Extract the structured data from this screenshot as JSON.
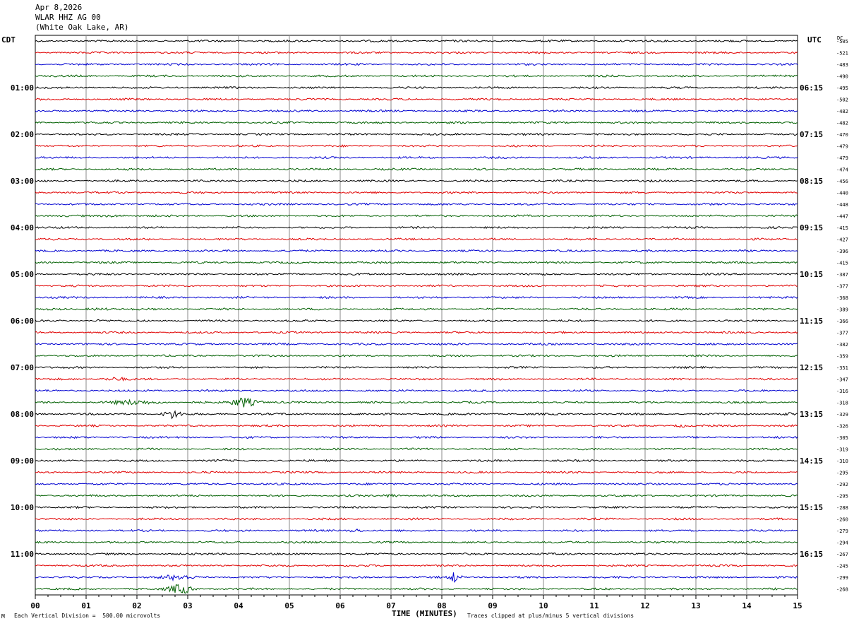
{
  "header": {
    "date": "Apr 8,2026",
    "station": "WLAR HHZ AG 00",
    "location": "(White Oak Lake, AR)"
  },
  "left_tz": "CDT",
  "right_tz": "UTC",
  "dc_label": "DC",
  "footer": {
    "scale": "Each Vertical Division =  500.00 microvolts",
    "clip": "Traces clipped at plus/minus 5 vertical divisions",
    "corner": "M"
  },
  "chart_data": {
    "type": "line",
    "title": "",
    "xlabel": "TIME (MINUTES)",
    "xlim": [
      0,
      15
    ],
    "x_ticks": [
      "00",
      "01",
      "02",
      "03",
      "04",
      "05",
      "06",
      "07",
      "08",
      "09",
      "10",
      "11",
      "12",
      "13",
      "14",
      "15"
    ],
    "trace_colors": [
      "#000000",
      "#e00000",
      "#0000d0",
      "#006000"
    ],
    "trace_count": 48,
    "left_time_labels": [
      {
        "row": 4,
        "label": "01:00"
      },
      {
        "row": 8,
        "label": "02:00"
      },
      {
        "row": 12,
        "label": "03:00"
      },
      {
        "row": 16,
        "label": "04:00"
      },
      {
        "row": 20,
        "label": "05:00"
      },
      {
        "row": 24,
        "label": "06:00"
      },
      {
        "row": 28,
        "label": "07:00"
      },
      {
        "row": 32,
        "label": "08:00"
      },
      {
        "row": 36,
        "label": "09:00"
      },
      {
        "row": 40,
        "label": "10:00"
      },
      {
        "row": 44,
        "label": "11:00"
      }
    ],
    "right_time_labels": [
      {
        "row": 4,
        "label": "06:15"
      },
      {
        "row": 8,
        "label": "07:15"
      },
      {
        "row": 12,
        "label": "08:15"
      },
      {
        "row": 16,
        "label": "09:15"
      },
      {
        "row": 20,
        "label": "10:15"
      },
      {
        "row": 24,
        "label": "11:15"
      },
      {
        "row": 28,
        "label": "12:15"
      },
      {
        "row": 32,
        "label": "13:15"
      },
      {
        "row": 36,
        "label": "14:15"
      },
      {
        "row": 40,
        "label": "15:15"
      },
      {
        "row": 44,
        "label": "16:15"
      }
    ],
    "dc_offsets": [
      "-505",
      "-521",
      "-483",
      "-490",
      "-495",
      "-502",
      "-482",
      "-482",
      "-470",
      "-479",
      "-479",
      "-474",
      "-456",
      "-440",
      "-448",
      "-447",
      "-415",
      "-427",
      "-396",
      "-415",
      "-387",
      "-377",
      "-368",
      "-389",
      "-366",
      "-377",
      "-382",
      "-359",
      "-351",
      "-347",
      "-316",
      "-318",
      "-329",
      "-326",
      "-305",
      "-319",
      "-310",
      "-295",
      "-292",
      "-295",
      "-288",
      "-260",
      "-279",
      "-294",
      "-267",
      "-245",
      "-299",
      "-268"
    ],
    "events": [
      {
        "row": 15,
        "start_min": 0.8,
        "end_min": 2.2,
        "amp": 2.0
      },
      {
        "row": 23,
        "start_min": 0.5,
        "end_min": 2.0,
        "amp": 2.0
      },
      {
        "row": 24,
        "start_min": 0.9,
        "end_min": 1.7,
        "amp": 2.0
      },
      {
        "row": 29,
        "start_min": 1.0,
        "end_min": 2.2,
        "amp": 3.0
      },
      {
        "row": 31,
        "start_min": 1.0,
        "end_min": 2.8,
        "amp": 4.0
      },
      {
        "row": 31,
        "start_min": 3.7,
        "end_min": 4.5,
        "amp": 8.0
      },
      {
        "row": 32,
        "start_min": 2.4,
        "end_min": 3.0,
        "amp": 7.0
      },
      {
        "row": 32,
        "start_min": 14.6,
        "end_min": 15.0,
        "amp": 3.0
      },
      {
        "row": 33,
        "start_min": 12.5,
        "end_min": 12.9,
        "amp": 3.0
      },
      {
        "row": 36,
        "start_min": 3.1,
        "end_min": 4.1,
        "amp": 2.0
      },
      {
        "row": 39,
        "start_min": 6.7,
        "end_min": 7.3,
        "amp": 3.0
      },
      {
        "row": 42,
        "start_min": 6.0,
        "end_min": 6.6,
        "amp": 3.0
      },
      {
        "row": 46,
        "start_min": 2.2,
        "end_min": 3.4,
        "amp": 5.0
      },
      {
        "row": 46,
        "start_min": 8.1,
        "end_min": 8.4,
        "amp": 9.0
      },
      {
        "row": 47,
        "start_min": 2.5,
        "end_min": 3.2,
        "amp": 9.0
      }
    ]
  }
}
